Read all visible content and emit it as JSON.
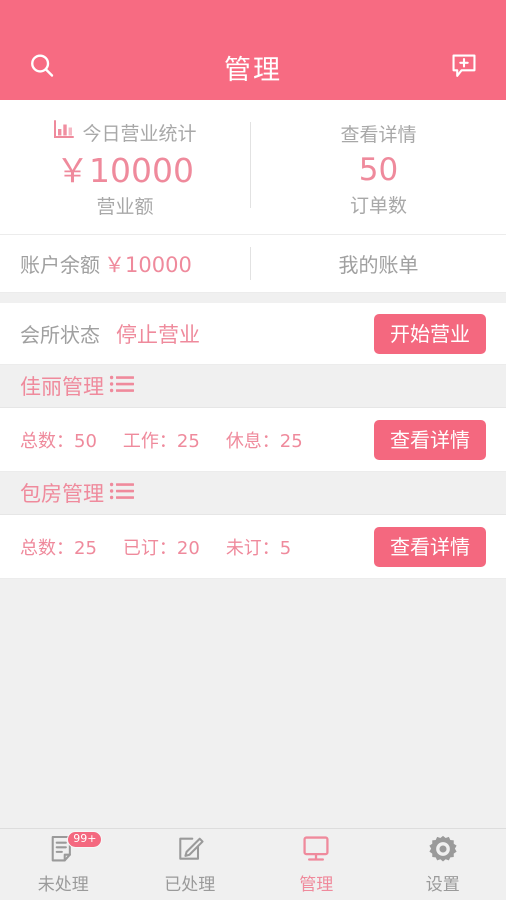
{
  "header": {
    "title": "管理",
    "search_icon": "search-icon",
    "add_message_icon": "message-plus-icon",
    "bg_color": "#f76b82"
  },
  "stats_card": {
    "left": {
      "chart_icon": "bar-chart-icon",
      "heading": "今日营业统计",
      "value": "￥10000",
      "label": "营业额"
    },
    "right": {
      "heading": "查看详情",
      "value": "50",
      "label": "订单数"
    }
  },
  "balance": {
    "label": "账户余额",
    "amount": "￥10000",
    "bill_link": "我的账单"
  },
  "status": {
    "label": "会所状态",
    "value": "停止营业",
    "button": "开始营业"
  },
  "sections": [
    {
      "title": "佳丽管理",
      "list_icon": "list-icon",
      "stats": [
        "总数：50",
        "工作：25",
        "休息：25"
      ],
      "button": "查看详情"
    },
    {
      "title": "包房管理",
      "list_icon": "list-icon",
      "stats": [
        "总数：25",
        "已订：20",
        "未订：5"
      ],
      "button": "查看详情"
    }
  ],
  "bottom_nav": [
    {
      "label": "未处理",
      "icon": "document-icon",
      "badge": "99+",
      "active": false
    },
    {
      "label": "已处理",
      "icon": "edit-pencil-icon",
      "badge": "",
      "active": false
    },
    {
      "label": "管理",
      "icon": "monitor-icon",
      "badge": "",
      "active": true
    },
    {
      "label": "设置",
      "icon": "gear-icon",
      "badge": "",
      "active": false
    }
  ],
  "colors": {
    "accent": "#f4687f",
    "header": "#f76b82",
    "text_pink": "#ef8a9c",
    "text_gray": "#a0a0a0",
    "page_bg": "#f0f0f0"
  }
}
